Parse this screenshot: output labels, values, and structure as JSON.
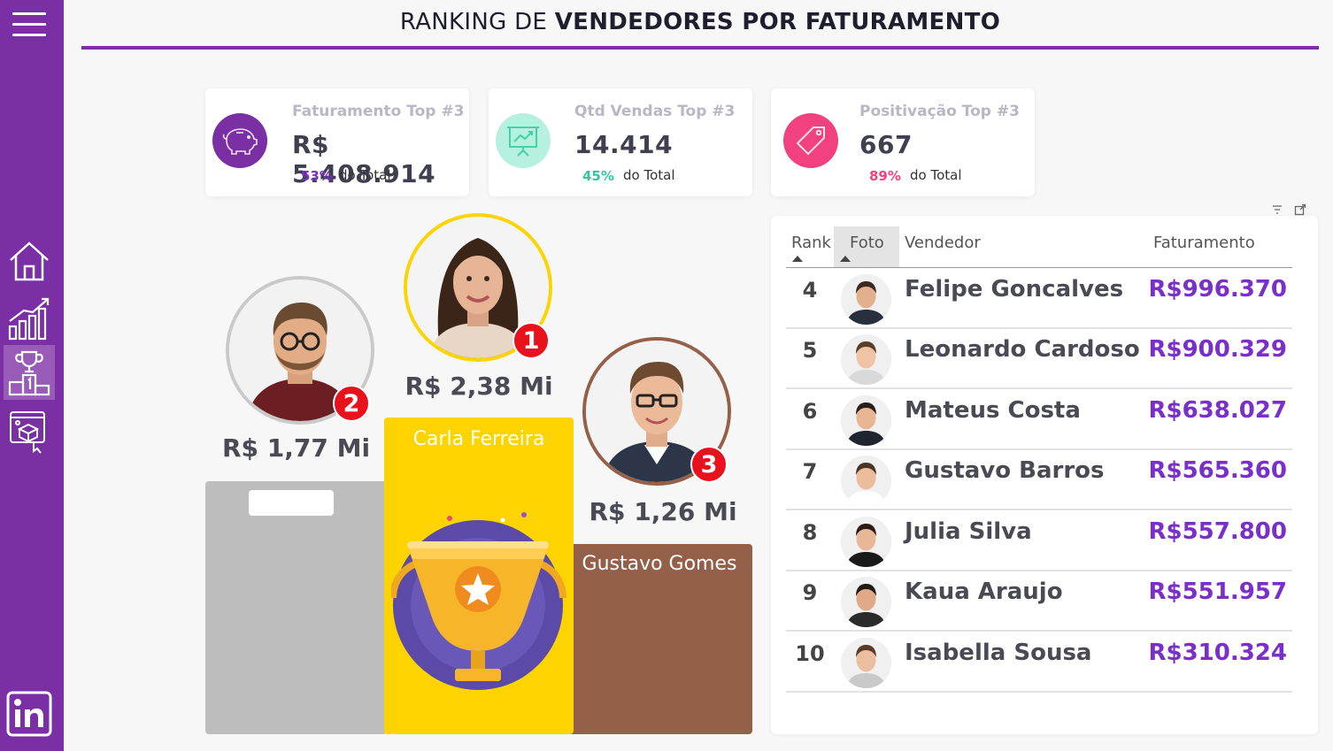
{
  "header": {
    "title_normal": "RANKING DE ",
    "title_bold": "VENDEDORES POR FATURAMENTO"
  },
  "sidebar": {
    "items": [
      {
        "name": "menu-icon"
      },
      {
        "name": "home-icon"
      },
      {
        "name": "bar-chart-icon"
      },
      {
        "name": "podium-trophy-icon"
      },
      {
        "name": "tablet-cube-icon"
      },
      {
        "name": "linkedin-icon"
      }
    ]
  },
  "kpis": [
    {
      "label": "Faturamento Top #3",
      "value": "R$ 5.408.914",
      "pct": "53%",
      "pct_text": "do Total",
      "color": "#7b2fa5",
      "icon": "piggy-bank-icon"
    },
    {
      "label": "Qtd Vendas Top #3",
      "value": "14.414",
      "pct": "45%",
      "pct_text": "do Total",
      "color": "#3fd4a8",
      "icon": "presentation-chart-icon"
    },
    {
      "label": "Positivação Top #3",
      "value": "667",
      "pct": "89%",
      "pct_text": "do Total",
      "color": "#f2417f",
      "icon": "tag-icon"
    }
  ],
  "podium": {
    "first": {
      "rank": "1",
      "value": "R$ 2,38 Mi",
      "name": "Carla Ferreira",
      "color": "#fdd300"
    },
    "second": {
      "rank": "2",
      "value": "R$ 1,77 Mi",
      "name": "",
      "color": "#bdbdbd"
    },
    "third": {
      "rank": "3",
      "value": "R$ 1,26 Mi",
      "name": "Gustavo Gomes",
      "color": "#94604a"
    }
  },
  "table": {
    "columns": [
      "Rank",
      "Foto",
      "Vendedor",
      "Faturamento"
    ],
    "rows": [
      {
        "rank": "4",
        "name": "Felipe Goncalves",
        "value": "R$996.370"
      },
      {
        "rank": "5",
        "name": "Leonardo Cardoso",
        "value": "R$900.329"
      },
      {
        "rank": "6",
        "name": "Mateus Costa",
        "value": "R$638.027"
      },
      {
        "rank": "7",
        "name": "Gustavo Barros",
        "value": "R$565.360"
      },
      {
        "rank": "8",
        "name": "Julia Silva",
        "value": "R$557.800"
      },
      {
        "rank": "9",
        "name": "Kaua Araujo",
        "value": "R$551.957"
      },
      {
        "rank": "10",
        "name": "Isabella Sousa",
        "value": "R$310.324"
      }
    ]
  },
  "colors": {
    "brand": "#7b2fa5",
    "value_purple": "#7b2fc9",
    "badge_red": "#e8121c"
  }
}
